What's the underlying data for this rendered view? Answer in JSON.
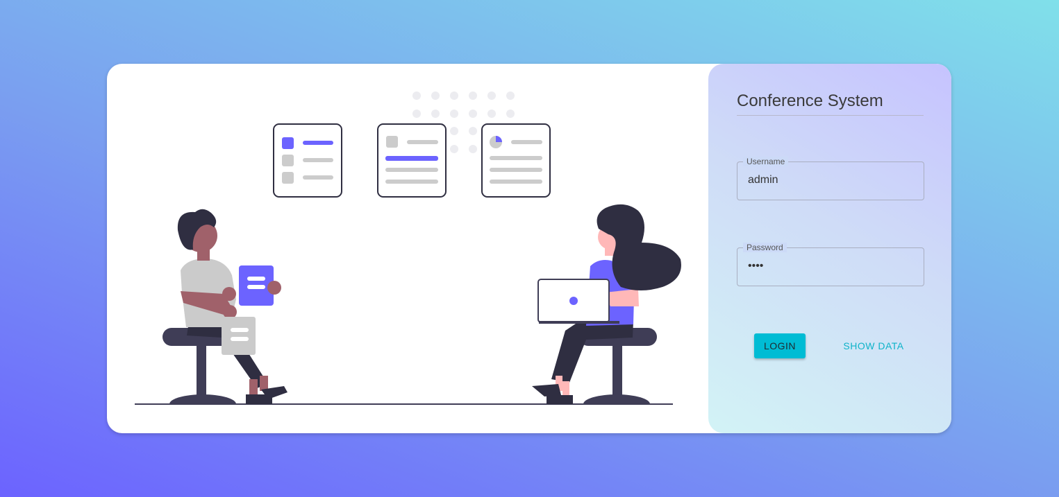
{
  "app": {
    "title": "Conference System"
  },
  "form": {
    "username": {
      "label": "Username",
      "value": "admin"
    },
    "password": {
      "label": "Password",
      "value": "••••"
    }
  },
  "actions": {
    "login_label": "LOGIN",
    "show_data_label": "SHOW DATA"
  },
  "colors": {
    "accent": "#6c63ff",
    "button": "#00bcd4",
    "link": "#0eb3c9",
    "dark": "#2f2e41",
    "skin_man": "#a0616a",
    "skin_woman": "#ffb8b8"
  },
  "illustration": {
    "name": "two-people-collaborating-illustration"
  }
}
